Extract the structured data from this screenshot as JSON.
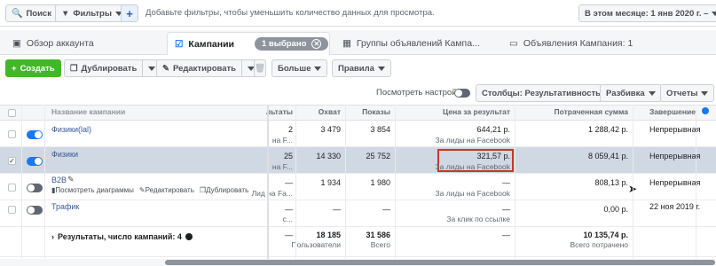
{
  "top": {
    "search": "Поиск",
    "filters": "Фильтры",
    "add_icon": "plus-icon",
    "hint": "Добавьте фильтры, чтобы уменьшить количество данных для просмотра.",
    "date": "В этом месяце: 1 янв 2020 г. –"
  },
  "tabs": {
    "overview": "Обзор аккаунта",
    "campaigns": "Кампании",
    "selected": "1 выбрано",
    "adsets": "Группы объявлений Кампа...",
    "ads": "Объявления Кампания: 1"
  },
  "toolbar": {
    "create": "Создать",
    "duplicate": "Дублировать",
    "edit": "Редактировать",
    "more": "Больше",
    "rules": "Правила"
  },
  "sub": {
    "view_settings": "Посмотреть настройки",
    "columns": "Столбцы: Результативность",
    "breakdown": "Разбивка",
    "reports": "Отчеты"
  },
  "header": {
    "name": "Название кампании",
    "results": "Результаты",
    "reach": "Охват",
    "impressions": "Показы",
    "cost": "Цена за результат",
    "spent": "Потраченная сумма",
    "end": "Завершение"
  },
  "rows": [
    {
      "name": "Физики(lal)",
      "results": "2",
      "results_sub": "на F...",
      "reach": "3 479",
      "impr": "3 854",
      "cost": "644,21 р.",
      "cost_sub": "За лиды на Facebook",
      "spent": "1 288,42 р.",
      "end": "Непрерывная"
    },
    {
      "name": "Физики",
      "results": "25",
      "results_sub": "на F...",
      "reach": "14 330",
      "impr": "25 752",
      "cost": "321,57 р.",
      "cost_sub": "За лиды на Facebook",
      "spent": "8 059,41 р.",
      "end": "Непрерывная"
    },
    {
      "name": "B2B",
      "results": "—",
      "results_sub": "Лид на Fa...",
      "reach": "1 934",
      "impr": "1 980",
      "cost": "—",
      "cost_sub": "За лиды на Facebook",
      "spent": "808,13 р.",
      "end": "Непрерывная",
      "actions": {
        "charts": "Посмотреть диаграммы",
        "edit": "Редактировать",
        "dup": "Дублировать"
      }
    },
    {
      "name": "Трафик",
      "results": "—",
      "results_sub": "с...",
      "reach": "—",
      "impr": "—",
      "cost": "—",
      "cost_sub": "За клик по ссылке",
      "spent": "0,00 р.",
      "end": "22 ноя 2019 г."
    }
  ],
  "totals": {
    "label": "Результаты, число кампаний: 4",
    "results": "—",
    "reach": "18 185",
    "reach_sub": "Пользователи",
    "impr": "31 586",
    "impr_sub": "Всего",
    "cost": "—",
    "spent": "10 135,74 р.",
    "spent_sub": "Всего потрачено"
  },
  "colors": {
    "accent": "#1877f2",
    "create": "#42b72a",
    "highlight": "#d0d8e3",
    "red_box": "#c0392b"
  }
}
